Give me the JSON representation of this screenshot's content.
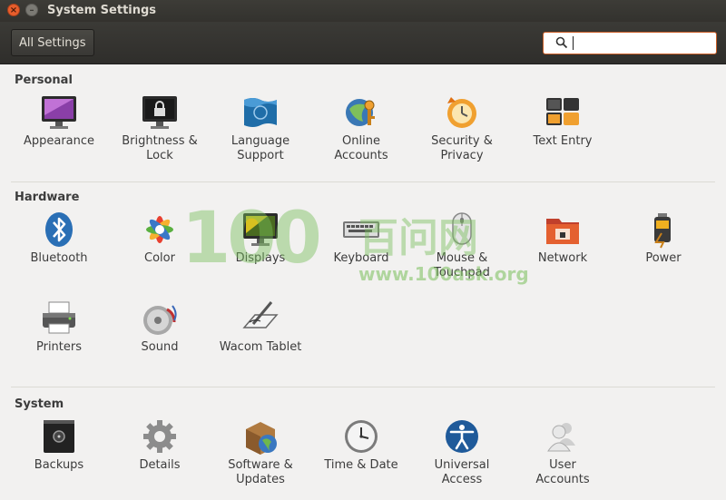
{
  "window": {
    "title": "System Settings"
  },
  "toolbar": {
    "all_settings_label": "All Settings",
    "search_value": "",
    "search_placeholder": ""
  },
  "sections": {
    "personal": {
      "title": "Personal",
      "items": [
        {
          "label": "Appearance",
          "icon": "appearance-icon"
        },
        {
          "label": "Brightness &\nLock",
          "icon": "brightness-lock-icon"
        },
        {
          "label": "Language\nSupport",
          "icon": "language-support-icon"
        },
        {
          "label": "Online\nAccounts",
          "icon": "online-accounts-icon"
        },
        {
          "label": "Security &\nPrivacy",
          "icon": "security-privacy-icon"
        },
        {
          "label": "Text Entry",
          "icon": "text-entry-icon"
        }
      ]
    },
    "hardware": {
      "title": "Hardware",
      "items": [
        {
          "label": "Bluetooth",
          "icon": "bluetooth-icon"
        },
        {
          "label": "Color",
          "icon": "color-icon"
        },
        {
          "label": "Displays",
          "icon": "displays-icon"
        },
        {
          "label": "Keyboard",
          "icon": "keyboard-icon"
        },
        {
          "label": "Mouse &\nTouchpad",
          "icon": "mouse-touchpad-icon"
        },
        {
          "label": "Network",
          "icon": "network-icon"
        },
        {
          "label": "Power",
          "icon": "power-icon"
        },
        {
          "label": "Printers",
          "icon": "printers-icon"
        },
        {
          "label": "Sound",
          "icon": "sound-icon"
        },
        {
          "label": "Wacom Tablet",
          "icon": "wacom-tablet-icon"
        }
      ]
    },
    "system": {
      "title": "System",
      "items": [
        {
          "label": "Backups",
          "icon": "backups-icon"
        },
        {
          "label": "Details",
          "icon": "details-icon"
        },
        {
          "label": "Software &\nUpdates",
          "icon": "software-updates-icon"
        },
        {
          "label": "Time & Date",
          "icon": "time-date-icon"
        },
        {
          "label": "Universal\nAccess",
          "icon": "universal-access-icon"
        },
        {
          "label": "User\nAccounts",
          "icon": "user-accounts-icon"
        }
      ]
    }
  },
  "watermark": {
    "number": "100",
    "chinese": "百问网",
    "url": "www.100ask.org"
  },
  "colors": {
    "accent": "#dd4814",
    "titlebar": "#3c3b37",
    "background": "#f2f1f0"
  }
}
